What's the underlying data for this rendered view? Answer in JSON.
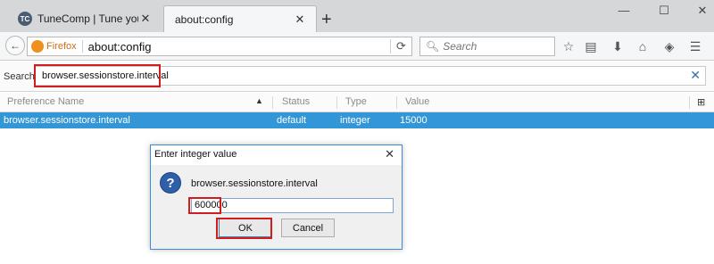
{
  "tabs": [
    {
      "title": "TuneComp | Tune your de",
      "favicon": "TC",
      "active": false
    },
    {
      "title": "about:config",
      "active": true
    }
  ],
  "window_controls": {
    "minimize": "—",
    "maximize": "☐",
    "close": "✕"
  },
  "navbar": {
    "identity_label": "Firefox",
    "url": "about:config",
    "search_placeholder": "Search"
  },
  "config": {
    "filter_label": "Search:",
    "filter_value": "browser.sessionstore.interval",
    "columns": {
      "name": "Preference Name",
      "status": "Status",
      "type": "Type",
      "value": "Value"
    },
    "rows": [
      {
        "name": "browser.sessionstore.interval",
        "status": "default",
        "type": "integer",
        "value": "15000"
      }
    ]
  },
  "dialog": {
    "title": "Enter integer value",
    "message": "browser.sessionstore.interval",
    "input_value": "600000",
    "ok_label": "OK",
    "cancel_label": "Cancel"
  },
  "colors": {
    "selection": "#3296d7",
    "highlight": "#d11d1d",
    "tabstrip": "#d6d7d9"
  }
}
